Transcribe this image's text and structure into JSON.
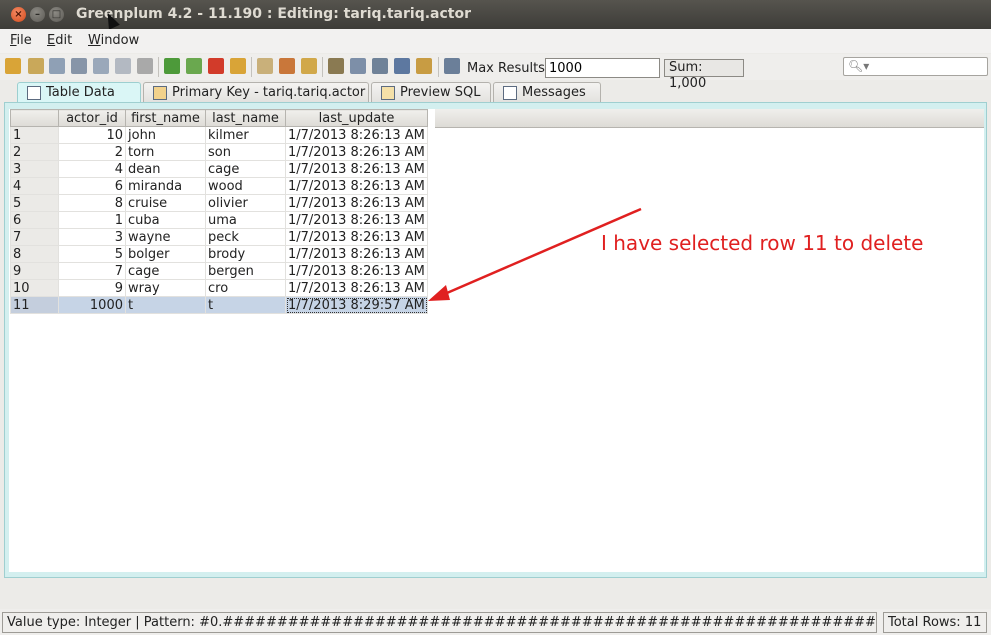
{
  "window": {
    "title": "Greenplum 4.2 - 11.190 : Editing: tariq.tariq.actor"
  },
  "menu": [
    "File",
    "Edit",
    "Window"
  ],
  "toolbar": {
    "max_results_label": "Max Results:",
    "max_results_value": "1000",
    "sum_label": "Sum: 1,000",
    "search_placeholder": ""
  },
  "tabs": [
    {
      "label": "Table Data",
      "active": true
    },
    {
      "label": "Primary Key - tariq.tariq.actor",
      "active": false
    },
    {
      "label": "Preview SQL",
      "active": false
    },
    {
      "label": "Messages",
      "active": false
    }
  ],
  "table": {
    "columns": [
      "actor_id",
      "first_name",
      "last_name",
      "last_update"
    ],
    "rows": [
      {
        "n": "1",
        "actor_id": "10",
        "first_name": "john",
        "last_name": "kilmer",
        "last_update": "1/7/2013 8:26:13 AM"
      },
      {
        "n": "2",
        "actor_id": "2",
        "first_name": "torn",
        "last_name": "son",
        "last_update": "1/7/2013 8:26:13 AM"
      },
      {
        "n": "3",
        "actor_id": "4",
        "first_name": "dean",
        "last_name": "cage",
        "last_update": "1/7/2013 8:26:13 AM"
      },
      {
        "n": "4",
        "actor_id": "6",
        "first_name": "miranda",
        "last_name": "wood",
        "last_update": "1/7/2013 8:26:13 AM"
      },
      {
        "n": "5",
        "actor_id": "8",
        "first_name": "cruise",
        "last_name": "olivier",
        "last_update": "1/7/2013 8:26:13 AM"
      },
      {
        "n": "6",
        "actor_id": "1",
        "first_name": "cuba",
        "last_name": "uma",
        "last_update": "1/7/2013 8:26:13 AM"
      },
      {
        "n": "7",
        "actor_id": "3",
        "first_name": "wayne",
        "last_name": "peck",
        "last_update": "1/7/2013 8:26:13 AM"
      },
      {
        "n": "8",
        "actor_id": "5",
        "first_name": "bolger",
        "last_name": "brody",
        "last_update": "1/7/2013 8:26:13 AM"
      },
      {
        "n": "9",
        "actor_id": "7",
        "first_name": "cage",
        "last_name": "bergen",
        "last_update": "1/7/2013 8:26:13 AM"
      },
      {
        "n": "10",
        "actor_id": "9",
        "first_name": "wray",
        "last_name": "cro",
        "last_update": "1/7/2013 8:26:13 AM"
      },
      {
        "n": "11",
        "actor_id": "1000",
        "first_name": "t",
        "last_name": "t",
        "last_update": "1/7/2013 8:29:57 AM",
        "selected": true
      }
    ]
  },
  "annotation": {
    "text": "I have selected row 11 to delete",
    "color": "#e02020"
  },
  "status": {
    "left": "Value type: Integer | Pattern: #0.###################################################################################",
    "right": "Total Rows: 11"
  },
  "colors": {
    "accent_tab": "#daf6f6",
    "selection": "#c6d4e6"
  }
}
